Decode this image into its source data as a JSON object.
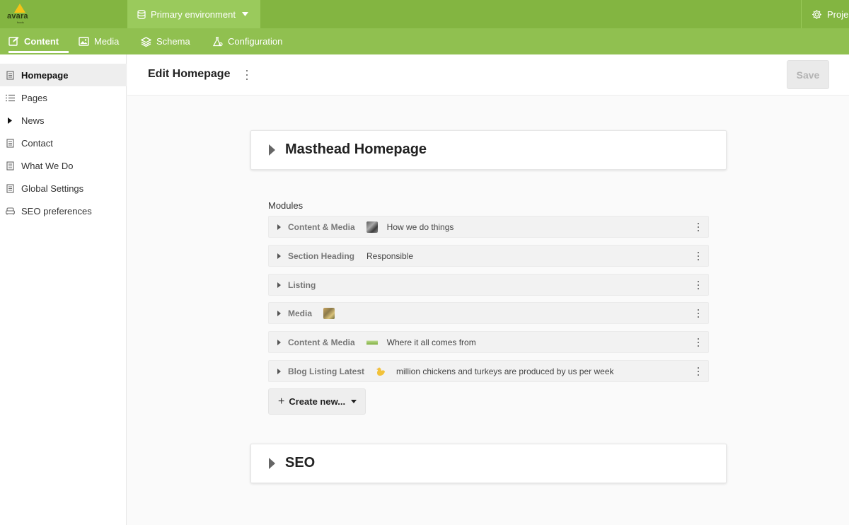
{
  "brand": {
    "logo_text": "avara",
    "logo_sub": "foods",
    "accent": "#83b541",
    "accent_light": "#9aca5c"
  },
  "topbar": {
    "environment_label": "Primary environment",
    "project_label": "Proje"
  },
  "nav": {
    "tabs": [
      {
        "label": "Content",
        "icon": "edit-icon",
        "active": true
      },
      {
        "label": "Media",
        "icon": "image-icon",
        "active": false
      },
      {
        "label": "Schema",
        "icon": "layers-icon",
        "active": false
      },
      {
        "label": "Configuration",
        "icon": "flask-icon",
        "active": false
      }
    ]
  },
  "sidebar": {
    "items": [
      {
        "label": "Homepage",
        "icon": "document-icon",
        "active": true
      },
      {
        "label": "Pages",
        "icon": "list-icon"
      },
      {
        "label": "News",
        "icon": "caret-right-icon"
      },
      {
        "label": "Contact",
        "icon": "document-icon"
      },
      {
        "label": "What We Do",
        "icon": "document-icon"
      },
      {
        "label": "Global Settings",
        "icon": "document-icon"
      },
      {
        "label": "SEO preferences",
        "icon": "sofa-icon"
      }
    ]
  },
  "main": {
    "title": "Edit Homepage",
    "save_label": "Save",
    "masthead_title": "Masthead Homepage",
    "modules_label": "Modules",
    "modules": [
      {
        "type": "Content & Media",
        "text": "How we do things",
        "thumb": "people-photo"
      },
      {
        "type": "Section Heading",
        "text": "Responsible"
      },
      {
        "type": "Listing",
        "text": ""
      },
      {
        "type": "Media",
        "text": "",
        "thumb": "field-photo"
      },
      {
        "type": "Content & Media",
        "text": "Where it all comes from",
        "thumb": "farm-photo"
      },
      {
        "type": "Blog Listing Latest",
        "text": "million chickens and turkeys are produced by us per week",
        "thumb": "chicken-icon"
      }
    ],
    "create_label": "Create new...",
    "seo_title": "SEO"
  }
}
